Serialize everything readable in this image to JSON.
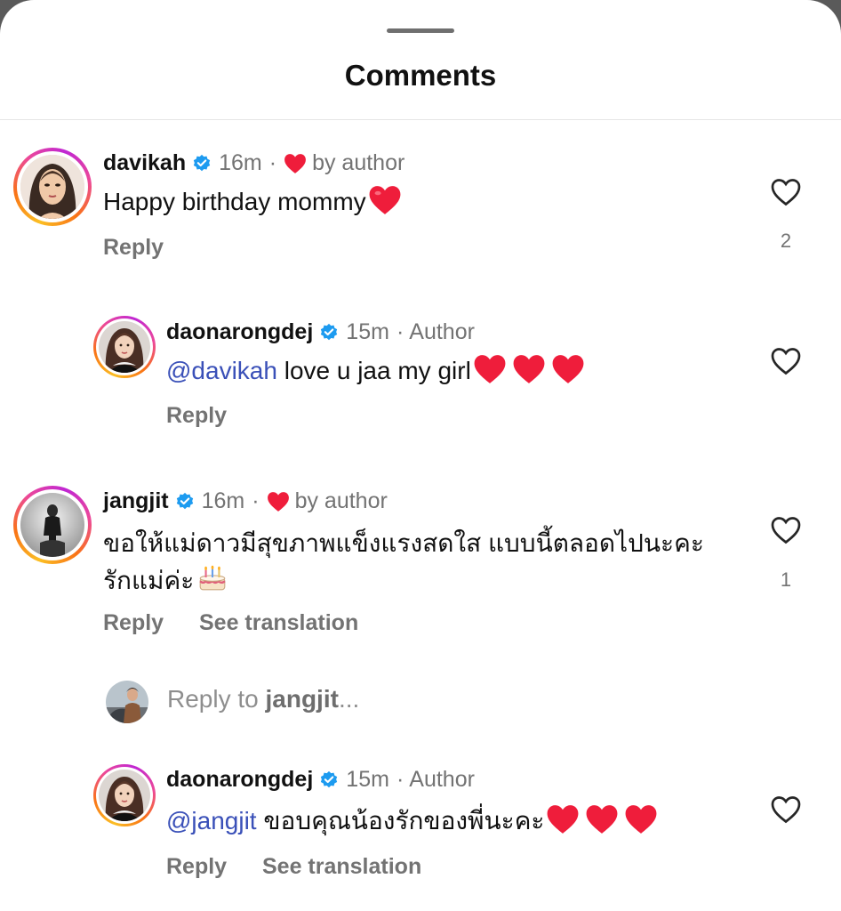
{
  "sheet": {
    "title": "Comments"
  },
  "comments": [
    {
      "username": "davikah",
      "time": "16m",
      "separator": "·",
      "liked_label": "by author",
      "text": "Happy birthday mommy",
      "reply_label": "Reply",
      "like_count": "2"
    },
    {
      "username": "daonarongdej",
      "time": "15m",
      "separator": "·",
      "role": "Author",
      "mention": "@davikah",
      "text": " love u jaa my girl",
      "reply_label": "Reply"
    },
    {
      "username": "jangjit",
      "time": "16m",
      "separator": "·",
      "liked_label": "by author",
      "text_line1": "ขอให้แม่ดาวมีสุขภาพแข็งแรงสดใส แบบนี้ตลอดไปนะคะ",
      "text_line2": "รักแม่ค่ะ",
      "reply_label": "Reply",
      "translate_label": "See translation",
      "like_count": "1"
    },
    {
      "username": "daonarongdej",
      "time": "15m",
      "separator": "·",
      "role": "Author",
      "mention": "@jangjit",
      "text": " ขอบคุณน้องรักของพี่นะคะ",
      "reply_label": "Reply",
      "translate_label": "See translation"
    }
  ],
  "reply_box": {
    "prefix": "Reply to ",
    "username": "jangjit",
    "suffix": "..."
  },
  "icons": {
    "verified": "verified-badge-icon",
    "like": "heart-outline-icon",
    "emoji": "red-heart-emoji",
    "cake": "birthday-cake-emoji"
  },
  "colors": {
    "mention": "#3a50b8",
    "verified": "#1d9bf0",
    "heart": "#ef1d3b",
    "muted": "#737373"
  }
}
